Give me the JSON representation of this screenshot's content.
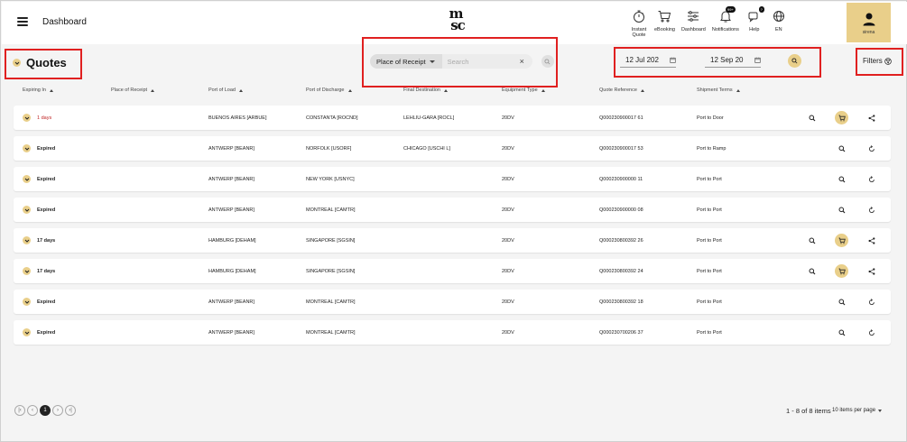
{
  "header": {
    "title": "Dashboard",
    "logo_line1": "m",
    "logo_line2": "sc",
    "nav": [
      {
        "label": "Instant\nQuote",
        "icon": "stopwatch-icon"
      },
      {
        "label": "eBooking",
        "icon": "cart-icon"
      },
      {
        "label": "Dashboard",
        "icon": "sliders-icon"
      },
      {
        "label": "Notifications",
        "icon": "bell-icon",
        "badge": "99+"
      },
      {
        "label": "Help",
        "icon": "help-chat-icon",
        "badge": "?"
      },
      {
        "label": "EN",
        "icon": "globe-icon"
      }
    ],
    "profile_name": "sirena"
  },
  "toolbar": {
    "title": "Quotes",
    "search_select": "Place of Receipt",
    "search_placeholder": "Search",
    "clear": "×",
    "date_from": "12 Jul 202",
    "date_to": "12 Sep 20",
    "filters_label": "Filters"
  },
  "columns": [
    "Expiring In",
    "Place of Receipt",
    "Port of Load",
    "Port of Discharge",
    "Final Destination",
    "Equipment Type",
    "Quote Reference",
    "Shipment Terms"
  ],
  "rows": [
    {
      "expiring": "1 days",
      "urgent": true,
      "receipt": "",
      "load": "BUENOS AIRES [ARBUE]",
      "discharge": "CONSTANTA [ROCND]",
      "final": "LEHLIU-GARA [ROCL]",
      "equipment": "20DV",
      "reference": "Q000230900017 61",
      "terms": "Port to Door",
      "actions": [
        "view",
        "cart",
        "share"
      ]
    },
    {
      "expiring": "Expired",
      "urgent": false,
      "receipt": "",
      "load": "ANTWERP [BEANR]",
      "discharge": "NORFOLK [USORF]",
      "final": "CHICAGO [USCHI L]",
      "equipment": "20DV",
      "reference": "Q000230900017 53",
      "terms": "Port to Ramp",
      "actions": [
        "view",
        "renew"
      ]
    },
    {
      "expiring": "Expired",
      "urgent": false,
      "receipt": "",
      "load": "ANTWERP [BEANR]",
      "discharge": "NEW YORK [USNYC]",
      "final": "",
      "equipment": "20DV",
      "reference": "Q000230900000 11",
      "terms": "Port to Port",
      "actions": [
        "view",
        "renew"
      ]
    },
    {
      "expiring": "Expired",
      "urgent": false,
      "receipt": "",
      "load": "ANTWERP [BEANR]",
      "discharge": "MONTREAL [CAMTR]",
      "final": "",
      "equipment": "20DV",
      "reference": "Q000230900000 08",
      "terms": "Port to Port",
      "actions": [
        "view",
        "renew"
      ]
    },
    {
      "expiring": "17 days",
      "urgent": false,
      "receipt": "",
      "load": "HAMBURG [DEHAM]",
      "discharge": "SINGAPORE [SGSIN]",
      "final": "",
      "equipment": "20DV",
      "reference": "Q000230800392 26",
      "terms": "Port to Port",
      "actions": [
        "view",
        "cart",
        "share"
      ]
    },
    {
      "expiring": "17 days",
      "urgent": false,
      "receipt": "",
      "load": "HAMBURG [DEHAM]",
      "discharge": "SINGAPORE [SGSIN]",
      "final": "",
      "equipment": "20DV",
      "reference": "Q000230800392 24",
      "terms": "Port to Port",
      "actions": [
        "view",
        "cart",
        "share"
      ]
    },
    {
      "expiring": "Expired",
      "urgent": false,
      "receipt": "",
      "load": "ANTWERP [BEANR]",
      "discharge": "MONTREAL [CAMTR]",
      "final": "",
      "equipment": "20DV",
      "reference": "Q000230800392 18",
      "terms": "Port to Port",
      "actions": [
        "view",
        "renew"
      ]
    },
    {
      "expiring": "Expired",
      "urgent": false,
      "receipt": "",
      "load": "ANTWERP [BEANR]",
      "discharge": "MONTREAL [CAMTR]",
      "final": "",
      "equipment": "20DV",
      "reference": "Q000230700206 37",
      "terms": "Port to Port",
      "actions": [
        "view",
        "renew"
      ]
    }
  ],
  "pagination": {
    "first": "|‹",
    "prev": "‹",
    "current": "1",
    "next": "›",
    "last": "›|",
    "range": "1 - 8 of 8 items",
    "per_page": "10 items per page"
  },
  "colors": {
    "accent": "#e9cf8a",
    "urgent": "#c02525",
    "annotation": "#e02020"
  }
}
